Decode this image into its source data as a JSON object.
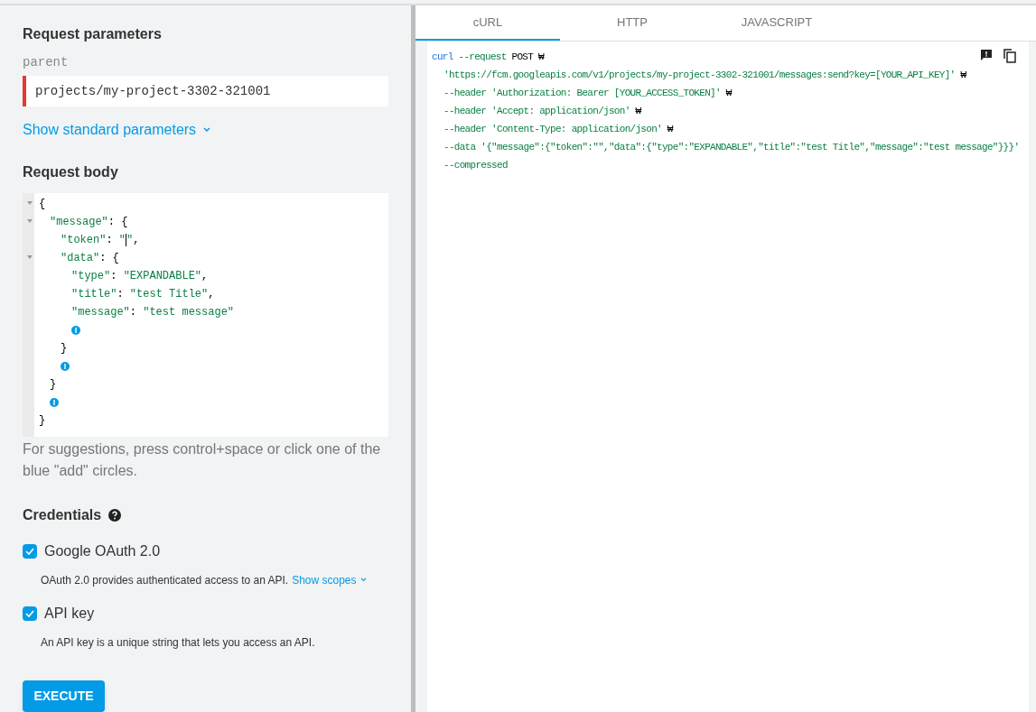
{
  "request_parameters": {
    "title": "Request parameters",
    "field_label": "parent",
    "field_value": "projects/my-project-3302-321001",
    "invalid": true,
    "show_link": "Show standard parameters"
  },
  "request_body": {
    "title": "Request body",
    "lines": [
      {
        "foldable": true,
        "parts": [
          {
            "text": "{",
            "kind": "punct"
          }
        ],
        "children": [
          {
            "foldable": true,
            "parts": [
              {
                "text": "\"message\"",
                "kind": "string"
              },
              {
                "text": ": {",
                "kind": "punct"
              }
            ],
            "children": [
              {
                "foldable": false,
                "parts": [
                  {
                    "text": "\"token\"",
                    "kind": "string"
                  },
                  {
                    "text": ": ",
                    "kind": "punct"
                  },
                  {
                    "text": "\"",
                    "kind": "string"
                  },
                  {
                    "text": "\"",
                    "kind": "string",
                    "caret": true
                  },
                  {
                    "text": ",",
                    "kind": "punct"
                  }
                ]
              },
              {
                "foldable": true,
                "parts": [
                  {
                    "text": "\"data\"",
                    "kind": "string"
                  },
                  {
                    "text": ": {",
                    "kind": "punct"
                  }
                ],
                "children": [
                  {
                    "foldable": false,
                    "parts": [
                      {
                        "text": "\"type\"",
                        "kind": "string"
                      },
                      {
                        "text": ": ",
                        "kind": "punct"
                      },
                      {
                        "text": "\"EXPANDABLE\"",
                        "kind": "string"
                      },
                      {
                        "text": ",",
                        "kind": "punct"
                      }
                    ]
                  },
                  {
                    "foldable": false,
                    "parts": [
                      {
                        "text": "\"title\"",
                        "kind": "string"
                      },
                      {
                        "text": ": ",
                        "kind": "punct"
                      },
                      {
                        "text": "\"test Title\"",
                        "kind": "string"
                      },
                      {
                        "text": ",",
                        "kind": "punct"
                      }
                    ]
                  },
                  {
                    "foldable": false,
                    "parts": [
                      {
                        "text": "\"message\"",
                        "kind": "string"
                      },
                      {
                        "text": ": ",
                        "kind": "punct"
                      },
                      {
                        "text": "\"test message\"",
                        "kind": "string"
                      }
                    ]
                  },
                  {
                    "kind": "add"
                  }
                ],
                "close": "}"
              },
              {
                "kind": "add"
              }
            ],
            "close": "}"
          },
          {
            "kind": "add"
          }
        ],
        "close": "}"
      }
    ],
    "hint": "For suggestions, press control+space or click one of the blue \"add\" circles."
  },
  "credentials": {
    "title": "Credentials",
    "items": [
      {
        "label": "Google OAuth 2.0",
        "checked": true,
        "description": "OAuth 2.0 provides authenticated access to an API.",
        "link": "Show scopes"
      },
      {
        "label": "API key",
        "checked": true,
        "description": "An API key is a unique string that lets you access an API."
      }
    ]
  },
  "execute_button": "EXECUTE",
  "tabs": [
    {
      "label": "cURL",
      "selected": true
    },
    {
      "label": "HTTP",
      "selected": false
    },
    {
      "label": "JAVASCRIPT",
      "selected": false
    }
  ],
  "code": [
    {
      "continued": false,
      "parts": [
        {
          "text": "curl",
          "kind": "command"
        },
        {
          "text": " --request",
          "kind": "string"
        },
        {
          "text": " POST ₩",
          "kind": "plain"
        }
      ]
    },
    {
      "continued": true,
      "parts": [
        {
          "text": "'https://fcm.googleapis.com/v1/projects/my-project-3302-321001/messages:send?key=[YOUR_API_KEY]'",
          "kind": "string"
        },
        {
          "text": " ₩",
          "kind": "plain"
        }
      ]
    },
    {
      "continued": true,
      "parts": [
        {
          "text": "--header 'Authorization: Bearer [YOUR_ACCESS_TOKEN]'",
          "kind": "string"
        },
        {
          "text": " ₩",
          "kind": "plain"
        }
      ]
    },
    {
      "continued": true,
      "parts": [
        {
          "text": "--header 'Accept: application/json'",
          "kind": "string"
        },
        {
          "text": " ₩",
          "kind": "plain"
        }
      ]
    },
    {
      "continued": true,
      "parts": [
        {
          "text": "--header 'Content-Type: application/json'",
          "kind": "string"
        },
        {
          "text": " ₩",
          "kind": "plain"
        }
      ]
    },
    {
      "continued": true,
      "parts": [
        {
          "text": "--data '{\"message\":{\"token\":\"\",\"data\":{\"type\":\"EXPANDABLE\",\"title\":\"test Title\",\"message\":\"test message\"}}}'",
          "kind": "string"
        }
      ]
    },
    {
      "continued": true,
      "parts": [
        {
          "text": "--compressed",
          "kind": "string"
        }
      ]
    }
  ]
}
